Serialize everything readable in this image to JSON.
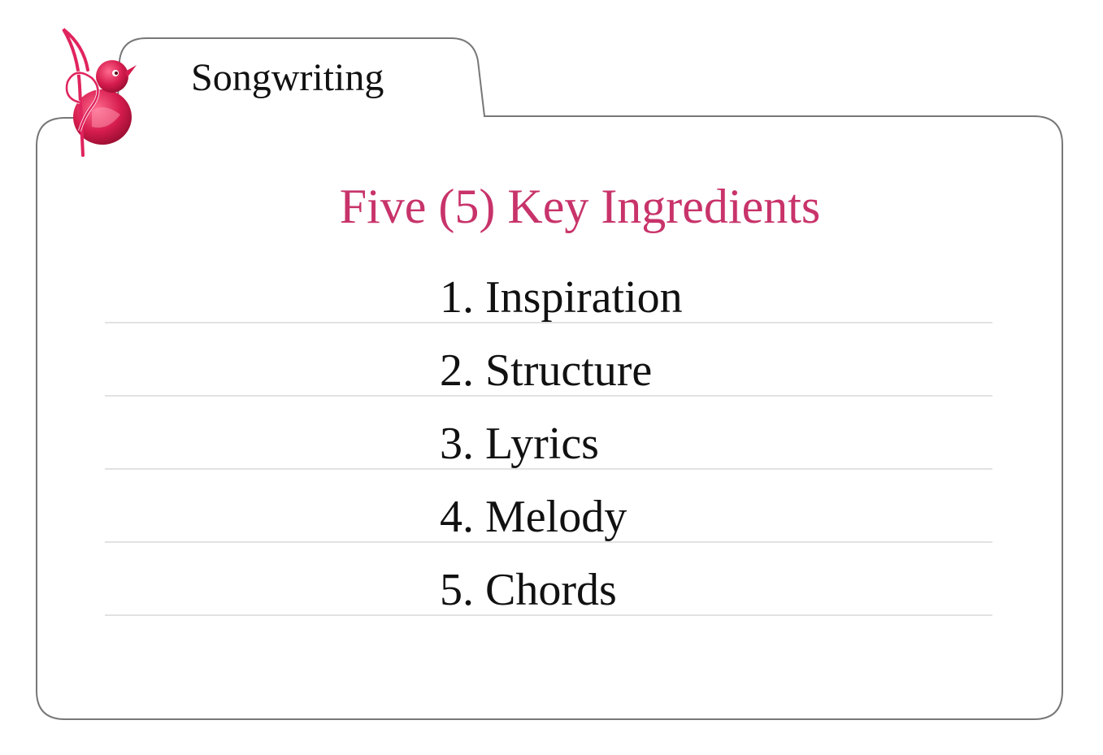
{
  "tab": {
    "title": "Songwriting"
  },
  "logo": {
    "icon": "bird-music-note-logo"
  },
  "main": {
    "title": "Five (5) Key Ingredients",
    "items": [
      "1. Inspiration",
      "2. Structure",
      "3. Lyrics",
      "4. Melody",
      "5. Chords"
    ]
  },
  "colors": {
    "accent": "#c8336a",
    "border": "#777777",
    "rule": "#e2e2e2",
    "text": "#111111"
  }
}
